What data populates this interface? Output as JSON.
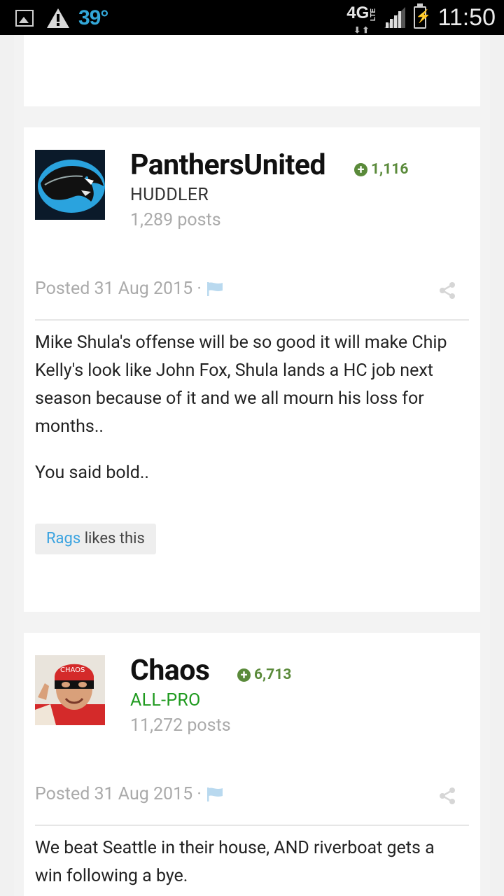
{
  "status_bar": {
    "temperature": "39°",
    "network": "4G",
    "network_sub": "LTE",
    "time": "11:50"
  },
  "posts": [
    {
      "username": "PanthersUnited",
      "reputation": "1,116",
      "rank": "HUDDLER",
      "post_count": "1,289 posts",
      "posted": "Posted 31 Aug 2015 ·",
      "paragraphs": [
        "Mike Shula's offense will be so good it will make Chip Kelly's look like John Fox, Shula lands a HC job next season because of it and we all mourn his loss for months..",
        "You said bold.."
      ],
      "liker": "Rags",
      "likes_suffix": " likes this"
    },
    {
      "username": "Chaos",
      "reputation": "6,713",
      "rank": "ALL-PRO",
      "post_count": "11,272 posts",
      "posted": "Posted 31 Aug 2015 ·",
      "paragraphs": [
        "We beat Seattle in their house, AND riverboat gets a win following a bye."
      ]
    }
  ],
  "colors": {
    "reputation_green": "#5a8a3a",
    "allpro_green": "#1f9a1f",
    "link_blue": "#3aa3e0",
    "temp_blue": "#33a7d8"
  }
}
